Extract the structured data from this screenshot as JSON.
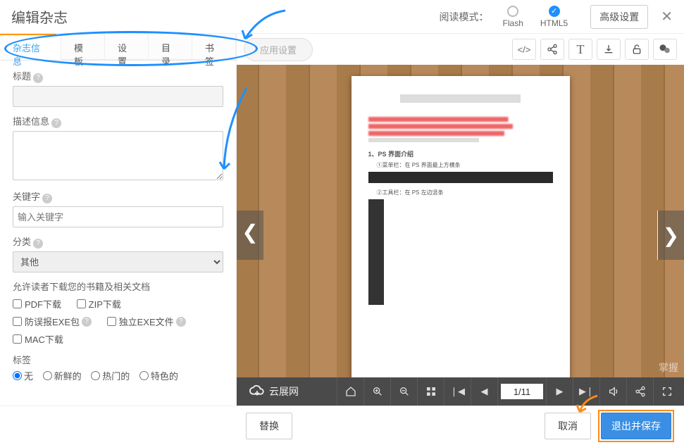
{
  "header": {
    "title": "编辑杂志",
    "reading_mode_label": "阅读模式：",
    "modes": {
      "flash": "Flash",
      "html5": "HTML5"
    },
    "advanced_button": "高级设置"
  },
  "tabs": {
    "items": [
      "杂志信息",
      "模板",
      "设置",
      "目录",
      "书签"
    ],
    "active_index": 0,
    "app_settings": "应用设置"
  },
  "form": {
    "title_label": "标题",
    "title_value": "",
    "desc_label": "描述信息",
    "desc_value": "",
    "keywords_label": "关键字",
    "keywords_placeholder": "输入关键字",
    "category_label": "分类",
    "category_value": "其他",
    "download_section": "允许读者下载您的书籍及相关文档",
    "downloads": {
      "pdf": "PDF下载",
      "zip": "ZIP下载",
      "exe_safe": "防误报EXE包",
      "exe_standalone": "独立EXE文件",
      "mac": "MAC下载"
    },
    "tags_label": "标签",
    "tags": {
      "none": "无",
      "fresh": "新鲜的",
      "hot": "热门的",
      "featured": "特色的"
    }
  },
  "preview": {
    "page_number": "1/11",
    "brand": "云展网",
    "watermark": "掌握",
    "doc": {
      "section_num": "1、",
      "section_title": "PS 界面介绍",
      "line1": "①菜单栏：在 PS 界面最上方横条",
      "line2": "②工具栏：在 PS 左边竖条"
    }
  },
  "footer": {
    "replace": "替换",
    "cancel": "取消",
    "save_exit": "退出并保存"
  }
}
